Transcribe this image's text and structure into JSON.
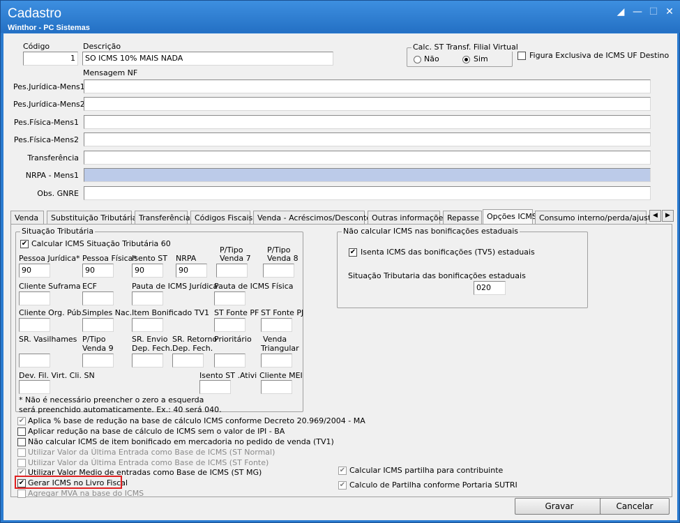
{
  "window": {
    "title": "Cadastro",
    "subtitle": "Winthor - PC Sistemas"
  },
  "header": {
    "codigo_label": "Código",
    "codigo_value": "1",
    "descricao_label": "Descrição",
    "descricao_value": "SO ICMS 10% MAIS NADA",
    "calc_st": {
      "label": "Calc. ST Transf. Filial Virtual",
      "opt_nao": "Não",
      "opt_sim": "Sim",
      "selected": "Sim"
    },
    "figura_label": "Figura Exclusiva de ICMS UF Destino",
    "mensagem_label": "Mensagem NF"
  },
  "message_fields": [
    {
      "label": "Pes.Jurídica-Mens1",
      "value": ""
    },
    {
      "label": "Pes.Jurídica-Mens2",
      "value": ""
    },
    {
      "label": "Pes.Física-Mens1",
      "value": ""
    },
    {
      "label": "Pes.Física-Mens2",
      "value": ""
    },
    {
      "label": "Transferência",
      "value": ""
    },
    {
      "label": "NRPA - Mens1",
      "value": ""
    },
    {
      "label": "Obs. GNRE",
      "value": ""
    }
  ],
  "tabs": [
    "Venda",
    "Substituição Tributária",
    "Transferência",
    "Códigos Fiscais",
    "Venda - Acréscimos/Descontos",
    "Outras informações",
    "Repasse",
    "Opções ICMS",
    "Consumo interno/perda/ajuste"
  ],
  "active_tab": "Opções ICMS",
  "situacao": {
    "title": "Situação Tributária",
    "calc60_label": "Calcular ICMS Situação Tributária 60",
    "fields": {
      "pj_label": "Pessoa Jurídica*",
      "pj_value": "90",
      "pf_label": "Pessoa Física*",
      "pf_value": "90",
      "isento_label": "Isento ST",
      "isento_value": "90",
      "nrpa_label": "NRPA",
      "nrpa_value": "90",
      "ptv7_label1": "P/Tipo",
      "ptv7_label2": "Venda 7",
      "ptv8_label1": "P/Tipo",
      "ptv8_label2": "Venda 8",
      "suframa_label": "Cliente Suframa",
      "ecf_label": "ECF",
      "pauta_pj_label": "Pauta de ICMS Jurídica",
      "pauta_pf_label": "Pauta de ICMS Física",
      "orgpub_label": "Cliente Org. Púb.",
      "simples_label": "Simples Nac.",
      "itembon_label": "Item Bonificado TV1",
      "stfpf_label": "ST Fonte PF",
      "stfpj_label": "ST Fonte PJ",
      "vasil_label": "SR. Vasilhames",
      "ptv9_label1": "P/Tipo",
      "ptv9_label2": "Venda 9",
      "srenvio_label1": "SR. Envio",
      "srenvio_label2": "Dep. Fech.",
      "srret_label1": "SR. Retorno",
      "srret_label2": "Dep. Fech.",
      "prior_label": "Prioritário",
      "vtri_label1": "Venda",
      "vtri_label2": "Triangular",
      "devfil_label": "Dev. Fil. Virt. Cli. SN",
      "isentoativi_label": "Isento ST .Ativi",
      "mei_label": "Cliente MEI"
    },
    "note1": "* Não é necessário preencher o zero a esquerda",
    "note2": "será preenchido automaticamente.  Ex.: 40 será 040."
  },
  "bonificacoes": {
    "title": "Não calcular ICMS nas bonificações estaduais",
    "isenta_label": "Isenta ICMS das bonificações (TV5) estaduais",
    "sit_label": "Situação Tributaria das  bonificações estaduais",
    "sit_value": "020"
  },
  "options": [
    {
      "label": "Aplica % base de redução na base de cálculo ICMS conforme Decreto 20.969/2004 - MA",
      "checked": true,
      "enabled": false
    },
    {
      "label": "Aplicar redução na base de cálculo de ICMS sem o valor de IPI - BA",
      "checked": false,
      "enabled": true
    },
    {
      "label": "Não calcular ICMS de item bonificado em mercadoria no pedido de venda (TV1)",
      "checked": false,
      "enabled": true
    },
    {
      "label": "Utilizar Valor da Última Entrada como Base de ICMS (ST Normal)",
      "checked": false,
      "enabled": false
    },
    {
      "label": "Utilizar Valor da Última Entrada como Base de ICMS (ST Fonte)",
      "checked": false,
      "enabled": false
    },
    {
      "label": "Utilizar Valor Medio de entradas como Base de ICMS (ST MG)",
      "checked": true,
      "enabled": false
    },
    {
      "label": "Gerar ICMS no Livro Fiscal",
      "checked": true,
      "enabled": true
    },
    {
      "label": "Agregar MVA na base do ICMS",
      "checked": false,
      "enabled": false
    }
  ],
  "right_options": [
    {
      "label": "Calcular ICMS partilha para contribuinte",
      "checked": true
    },
    {
      "label": "Calculo de Partilha conforme Portaria SUTRI",
      "checked": true
    }
  ],
  "buttons": {
    "gravar": "Gravar",
    "cancelar": "Cancelar"
  },
  "colors": {
    "titlebar": "#2a7bd0",
    "highlight": "#e02020",
    "selected_field": "#bccbe9"
  }
}
